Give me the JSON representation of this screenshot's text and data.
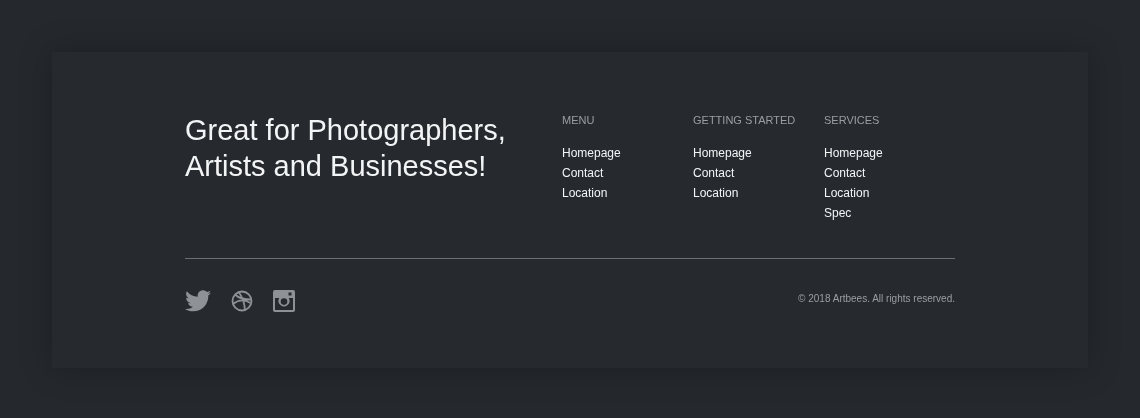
{
  "headline": {
    "lines": [
      "Great for Photographers,",
      "Artists and Businesses!"
    ]
  },
  "columns": [
    {
      "heading": "MENU",
      "links": [
        "Homepage",
        "Contact",
        "Location"
      ]
    },
    {
      "heading": "GETTING STARTED",
      "links": [
        "Homepage",
        "Contact",
        "Location"
      ]
    },
    {
      "heading": "SERVICES",
      "links": [
        "Homepage",
        "Contact",
        "Location",
        "Spec"
      ]
    }
  ],
  "social": [
    {
      "kind": "twitter"
    },
    {
      "kind": "dribbble"
    },
    {
      "kind": "instagram"
    }
  ],
  "copyright": "© 2018 Artbees. All rights reserved."
}
